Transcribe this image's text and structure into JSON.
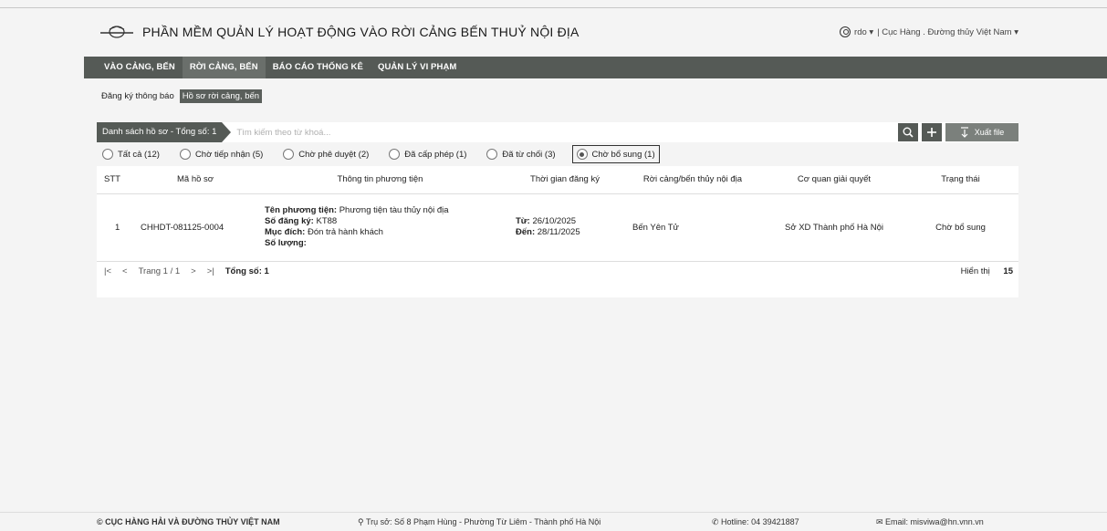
{
  "app": {
    "title": "PHẦN MỀM QUẢN LÝ HOẠT ĐỘNG VÀO RỜI CẢNG BẾN THUỶ NỘI ĐỊA",
    "user": "rdo ▾",
    "org": "| Cục Hàng . Đường thủy Việt Nam ▾"
  },
  "nav": [
    {
      "label": "VÀO CẢNG, BẾN",
      "active": false
    },
    {
      "label": "RỜI CẢNG, BẾN",
      "active": true
    },
    {
      "label": "BÁO CÁO THỐNG KÊ",
      "active": false
    },
    {
      "label": "QUẢN LÝ VI PHẠM",
      "active": false
    }
  ],
  "subtabs": [
    {
      "label": "Đăng ký thông báo",
      "active": false
    },
    {
      "label": "Hồ sơ rời cảng, bến",
      "active": true
    }
  ],
  "list": {
    "tab_label": "Danh sách hồ sơ - Tổng số: 1",
    "search_placeholder": "Tìm kiếm theo từ khoá...",
    "export_label": "Xuất file"
  },
  "filters": [
    {
      "label": "Tất cả (12)",
      "checked": false
    },
    {
      "label": "Chờ tiếp nhận (5)",
      "checked": false
    },
    {
      "label": "Chờ phê duyệt (2)",
      "checked": false
    },
    {
      "label": "Đã cấp phép (1)",
      "checked": false
    },
    {
      "label": "Đã từ chối (3)",
      "checked": false
    },
    {
      "label": "Chờ bổ sung (1)",
      "checked": true
    }
  ],
  "table": {
    "headers": [
      "STT",
      "Mã hồ sơ",
      "Thông tin phương tiện",
      "Thời gian đăng ký",
      "Rời cảng/bến thủy nội địa",
      "Cơ quan giải quyết",
      "Trạng thái"
    ],
    "rows": [
      {
        "stt": "1",
        "code": "CHHDT-081125-0004",
        "vehicle_name_label": "Tên phương tiện:",
        "vehicle_name": "Phương tiện tàu thủy nội địa",
        "reg_label": "Số đăng ký:",
        "reg": "KT88",
        "purpose_label": "Mục đích:",
        "purpose": "Đón trả hành khách",
        "qty_label": "Số lượng:",
        "qty": "",
        "from_label": "Từ:",
        "from": "26/10/2025",
        "to_label": "Đến:",
        "to": "28/11/2025",
        "port": "Bến Yên Tử",
        "agency": "Sở XD Thành phố Hà Nội",
        "status": "Chờ bổ sung"
      }
    ]
  },
  "pager": {
    "first": "|<",
    "prev": "<",
    "page": "Trang 1 / 1",
    "next": ">",
    "last": ">|",
    "total_label": "Tổng số: 1",
    "show_label": "Hiển thị",
    "show_value": "15"
  },
  "footer": {
    "org": "© CỤC HÀNG HẢI VÀ ĐƯỜNG THỦY VIỆT NAM",
    "address": "Trụ sở: Số 8 Phạm Hùng - Phường Từ Liêm - Thành phố Hà Nội",
    "hotline": "Hotline: 04 39421887",
    "email": "Email: misviwa@hn.vnn.vn"
  }
}
